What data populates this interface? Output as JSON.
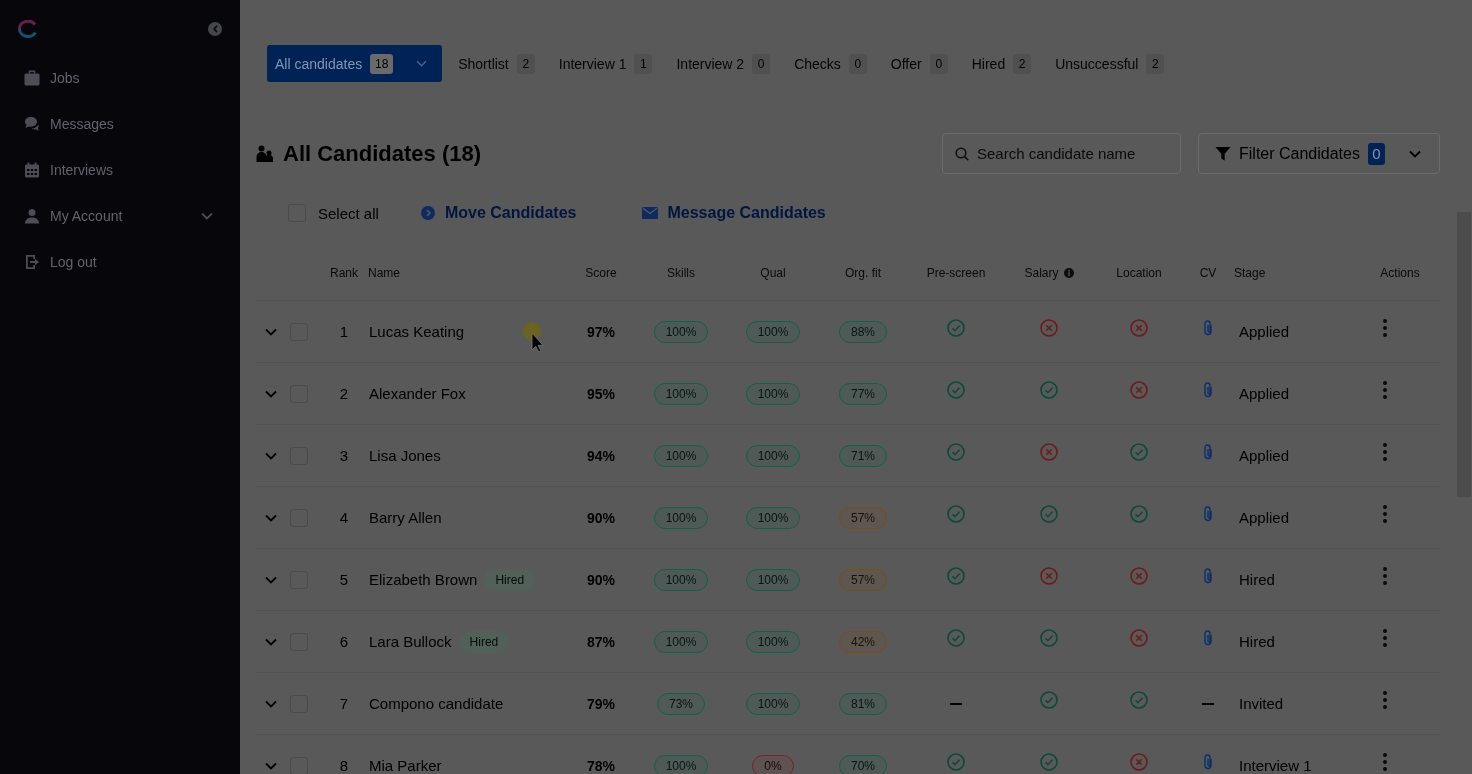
{
  "sidebar": {
    "items": [
      {
        "label": "Jobs",
        "kind": "link"
      },
      {
        "label": "Messages",
        "kind": "link"
      },
      {
        "label": "Interviews",
        "kind": "link"
      },
      {
        "label": "My Account",
        "kind": "group",
        "expanded": false
      },
      {
        "label": "Log out",
        "kind": "link"
      }
    ]
  },
  "tabs": [
    {
      "label": "All candidates",
      "count": "18",
      "selected": true
    },
    {
      "label": "Shortlist",
      "count": "2",
      "selected": false
    },
    {
      "label": "Interview 1",
      "count": "1",
      "selected": false
    },
    {
      "label": "Interview 2",
      "count": "0",
      "selected": false
    },
    {
      "label": "Checks",
      "count": "0",
      "selected": false
    },
    {
      "label": "Offer",
      "count": "0",
      "selected": false
    },
    {
      "label": "Hired",
      "count": "2",
      "selected": false
    },
    {
      "label": "Unsuccessful",
      "count": "2",
      "selected": false
    }
  ],
  "heading": {
    "title": "All Candidates (18)"
  },
  "search": {
    "placeholder": "Search candidate name"
  },
  "filter": {
    "label": "Filter Candidates",
    "count": "0"
  },
  "toolbar": {
    "select_all": {
      "label": "Select all",
      "checked": false
    },
    "actions": [
      {
        "label": "Move Candidates"
      },
      {
        "label": "Message Candidates"
      }
    ]
  },
  "table": {
    "columns": [
      {
        "label": "Rank"
      },
      {
        "label": "Name"
      },
      {
        "label": "Score"
      },
      {
        "label": "Skills"
      },
      {
        "label": "Qual"
      },
      {
        "label": "Org. fit"
      },
      {
        "label": "Pre-screen"
      },
      {
        "label": "Salary",
        "info": true
      },
      {
        "label": "Location"
      },
      {
        "label": "CV"
      },
      {
        "label": "Stage"
      },
      {
        "label": "Actions"
      }
    ],
    "rows": [
      {
        "rank": "1",
        "name": "Lucas Keating",
        "score": "97%",
        "skills": {
          "text": "100%",
          "color": "#11604d"
        },
        "qual": {
          "text": "100%",
          "color": "#11604d"
        },
        "org_fit": {
          "text": "88%",
          "color": "#11604d"
        },
        "checks": [
          {
            "kind": "check"
          },
          {
            "kind": "cross"
          },
          {
            "kind": "cross"
          }
        ],
        "cv": true,
        "stage": "Applied",
        "checked": false,
        "expanded": false
      },
      {
        "rank": "2",
        "name": "Alexander Fox",
        "score": "95%",
        "skills": {
          "text": "100%",
          "color": "#11604d"
        },
        "qual": {
          "text": "100%",
          "color": "#11604d"
        },
        "org_fit": {
          "text": "77%",
          "color": "#11604d"
        },
        "checks": [
          {
            "kind": "check"
          },
          {
            "kind": "check"
          },
          {
            "kind": "cross"
          }
        ],
        "cv": true,
        "stage": "Applied",
        "checked": false,
        "expanded": false
      },
      {
        "rank": "3",
        "name": "Lisa Jones",
        "score": "94%",
        "skills": {
          "text": "100%",
          "color": "#11604d"
        },
        "qual": {
          "text": "100%",
          "color": "#11604d"
        },
        "org_fit": {
          "text": "71%",
          "color": "#11604d"
        },
        "checks": [
          {
            "kind": "check"
          },
          {
            "kind": "cross"
          },
          {
            "kind": "check"
          }
        ],
        "cv": true,
        "stage": "Applied",
        "checked": false,
        "expanded": false
      },
      {
        "rank": "4",
        "name": "Barry Allen",
        "score": "90%",
        "skills": {
          "text": "100%",
          "color": "#11604d"
        },
        "qual": {
          "text": "100%",
          "color": "#11604d"
        },
        "org_fit": {
          "text": "57%",
          "color": "#7a4d1a"
        },
        "checks": [
          {
            "kind": "check"
          },
          {
            "kind": "check"
          },
          {
            "kind": "check"
          }
        ],
        "cv": true,
        "stage": "Applied",
        "checked": false,
        "expanded": false
      },
      {
        "rank": "5",
        "name": "Elizabeth Brown",
        "tag": "Hired",
        "score": "90%",
        "skills": {
          "text": "100%",
          "color": "#11604d"
        },
        "qual": {
          "text": "100%",
          "color": "#11604d"
        },
        "org_fit": {
          "text": "57%",
          "color": "#7a4d1a"
        },
        "checks": [
          {
            "kind": "check"
          },
          {
            "kind": "cross"
          },
          {
            "kind": "cross"
          }
        ],
        "cv": true,
        "stage": "Hired",
        "checked": false,
        "expanded": false
      },
      {
        "rank": "6",
        "name": "Lara Bullock",
        "tag": "Hired",
        "score": "87%",
        "skills": {
          "text": "100%",
          "color": "#11604d"
        },
        "qual": {
          "text": "100%",
          "color": "#11604d"
        },
        "org_fit": {
          "text": "42%",
          "color": "#7a4d1a"
        },
        "checks": [
          {
            "kind": "check"
          },
          {
            "kind": "check"
          },
          {
            "kind": "cross"
          }
        ],
        "cv": true,
        "stage": "Hired",
        "checked": false,
        "expanded": false
      },
      {
        "rank": "7",
        "name": "Compono candidate",
        "score": "79%",
        "skills": {
          "text": "73%",
          "color": "#11604d"
        },
        "qual": {
          "text": "100%",
          "color": "#11604d"
        },
        "org_fit": {
          "text": "81%",
          "color": "#11604d"
        },
        "checks": [
          {
            "kind": "dash"
          },
          {
            "kind": "check"
          },
          {
            "kind": "check"
          }
        ],
        "cv": false,
        "stage": "Invited",
        "checked": false,
        "expanded": false
      },
      {
        "rank": "8",
        "name": "Mia Parker",
        "score": "78%",
        "skills": {
          "text": "100%",
          "color": "#11604d"
        },
        "qual": {
          "text": "0%",
          "color": "#7a2424"
        },
        "org_fit": {
          "text": "70%",
          "color": "#11604d"
        },
        "checks": [
          {
            "kind": "check"
          },
          {
            "kind": "check"
          },
          {
            "kind": "cross"
          }
        ],
        "cv": true,
        "stage": "Interview 1",
        "checked": false,
        "expanded": false
      }
    ]
  }
}
